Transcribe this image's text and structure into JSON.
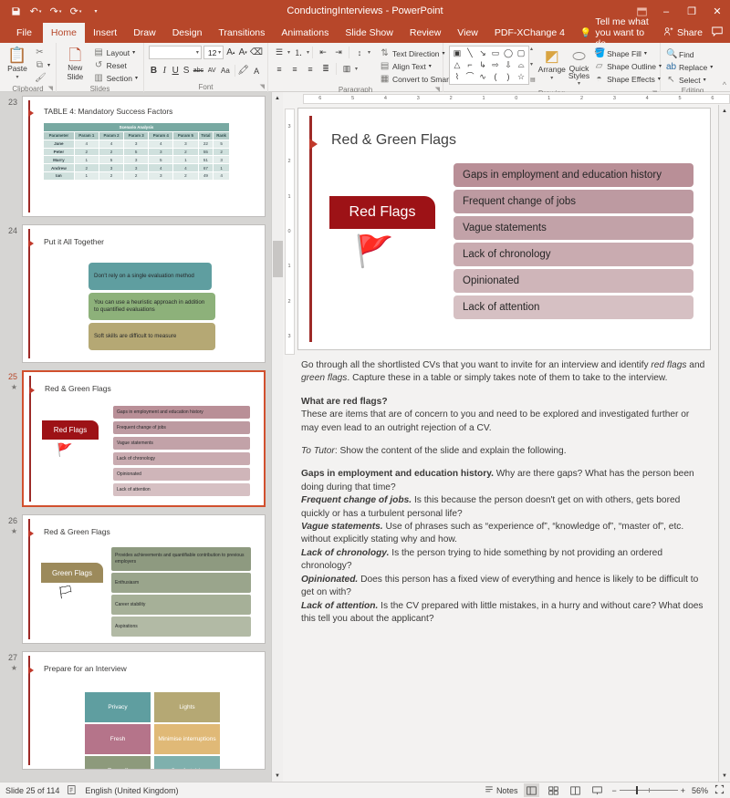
{
  "titlebar": {
    "document_title": "ConductingInterviews  -  PowerPoint",
    "qat": [
      "save-icon",
      "undo-icon",
      "redo-icon",
      "start-slideshow-icon",
      "customize-qat-icon"
    ],
    "ribbon_display_options": "ribbon-display-options-icon",
    "minimize": "–",
    "restore": "❐",
    "close": "✕"
  },
  "tabs": [
    {
      "label": "File",
      "active": false
    },
    {
      "label": "Home",
      "active": true
    },
    {
      "label": "Insert",
      "active": false
    },
    {
      "label": "Draw",
      "active": false
    },
    {
      "label": "Design",
      "active": false
    },
    {
      "label": "Transitions",
      "active": false
    },
    {
      "label": "Animations",
      "active": false
    },
    {
      "label": "Slide Show",
      "active": false
    },
    {
      "label": "Review",
      "active": false
    },
    {
      "label": "View",
      "active": false
    },
    {
      "label": "PDF-XChange 4",
      "active": false
    }
  ],
  "tellme": "Tell me what you want to do",
  "share_label": "Share",
  "ribbon": {
    "groups": {
      "clipboard": {
        "label": "Clipboard",
        "paste": "Paste",
        "cut": "Cut",
        "copy": "Copy",
        "format_painter": "Format Painter"
      },
      "slides": {
        "label": "Slides",
        "new_slide": "New Slide",
        "layout": "Layout",
        "reset": "Reset",
        "section": "Section"
      },
      "font": {
        "label": "Font",
        "font_name": "",
        "font_size": "12",
        "bold": "B",
        "italic": "I",
        "underline": "U",
        "shadow": "S",
        "strikethrough": "abc",
        "char_spacing": "AV",
        "change_case": "Aa",
        "grow_font": "A",
        "shrink_font": "A",
        "clear_formatting": "clear-formatting-icon",
        "text_highlight": "text-highlight-icon",
        "font_color": "A"
      },
      "paragraph": {
        "label": "Paragraph",
        "bullets": "bullets-icon",
        "numbering": "numbering-icon",
        "decrease_indent": "decrease-indent-icon",
        "increase_indent": "increase-indent-icon",
        "line_spacing": "line-spacing-icon",
        "text_direction": "Text Direction",
        "align_text": "Align Text",
        "convert_smartart": "Convert to SmartArt",
        "align_left": "align-left-icon",
        "align_center": "align-center-icon",
        "align_right": "align-right-icon",
        "justify": "justify-icon",
        "columns": "columns-icon"
      },
      "drawing": {
        "label": "Drawing",
        "arrange": "Arrange",
        "quick_styles": "Quick Styles",
        "shape_fill": "Shape Fill",
        "shape_outline": "Shape Outline",
        "shape_effects": "Shape Effects",
        "shape_glyphs": [
          "▣",
          "╲",
          "↘",
          "▭",
          "◯",
          "▢",
          "△",
          "⌐",
          "↳",
          "⇨",
          "⇩",
          "⌒",
          "⌇",
          "⌒",
          "∿",
          "(",
          ")",
          "☆"
        ]
      },
      "editing": {
        "label": "Editing",
        "find": "Find",
        "replace": "Replace",
        "select": "Select"
      }
    },
    "collapse_ribbon": "^"
  },
  "ruler": {
    "horizontal_ticks": [
      "6",
      "5",
      "4",
      "3",
      "2",
      "1",
      "0",
      "1",
      "2",
      "3",
      "4",
      "5",
      "6"
    ],
    "vertical_ticks": [
      "3",
      "2",
      "1",
      "0",
      "1",
      "2",
      "3"
    ]
  },
  "thumbnails": [
    {
      "number": "23",
      "animated": false,
      "selected": false,
      "title": "TABLE 4: Mandatory Success Factors",
      "kind": "table",
      "table": {
        "caption": "Scenario Analysis",
        "headers": [
          "Parameter",
          "Param 1",
          "Param 2",
          "Param 3",
          "Param 4",
          "Param 5",
          "Total",
          "Rank"
        ],
        "rows": [
          [
            "Jane",
            "4",
            "4",
            "3",
            "4",
            "3",
            "22",
            "5"
          ],
          [
            "Peter",
            "2",
            "2",
            "5",
            "3",
            "2",
            "55",
            "2"
          ],
          [
            "Marry",
            "1",
            "5",
            "3",
            "5",
            "1",
            "51",
            "3"
          ],
          [
            "Andrew",
            "2",
            "3",
            "3",
            "4",
            "4",
            "67",
            "1"
          ],
          [
            "Ian",
            "1",
            "2",
            "2",
            "3",
            "2",
            "49",
            "4"
          ]
        ]
      }
    },
    {
      "number": "24",
      "animated": false,
      "selected": false,
      "title": "Put it All Together",
      "kind": "pills",
      "pills": [
        {
          "text": "Don't rely on a single evaluation method",
          "color": "#5f9ea0"
        },
        {
          "text": "You can use a heuristic approach in addition to quantified evaluations",
          "color": "#8db17a"
        },
        {
          "text": "Soft skills are difficult to measure",
          "color": "#b5a874"
        }
      ]
    },
    {
      "number": "25",
      "animated": true,
      "selected": true,
      "title": "Red & Green Flags",
      "kind": "flags",
      "badge": {
        "text": "Red Flags",
        "color": "#9d1216"
      },
      "flag_icon": "red-flag-icon",
      "items": [
        {
          "text": "Gaps in employment and education history",
          "color": "#b98f97"
        },
        {
          "text": "Frequent change of jobs",
          "color": "#bd9aa1"
        },
        {
          "text": "Vague statements",
          "color": "#c2a2a8"
        },
        {
          "text": "Lack of chronology",
          "color": "#c9abb0"
        },
        {
          "text": "Opinionated",
          "color": "#cfb5b9"
        },
        {
          "text": "Lack of attention",
          "color": "#d6c0c3"
        }
      ]
    },
    {
      "number": "26",
      "animated": true,
      "selected": false,
      "title": "Red & Green Flags",
      "kind": "flags",
      "badge": {
        "text": "Green Flags",
        "color": "#9c8a5b"
      },
      "flag_icon": "green-flag-icon",
      "items": [
        {
          "text": "Provides achievements and quantifiable contribution to previous employers",
          "color": "#8e9a80"
        },
        {
          "text": "Enthusiasm",
          "color": "#9aa58c"
        },
        {
          "text": "Career stability",
          "color": "#a6b098"
        },
        {
          "text": "Aspirations",
          "color": "#b2baa5"
        }
      ]
    },
    {
      "number": "27",
      "animated": true,
      "selected": false,
      "title": "Prepare for an Interview",
      "kind": "tiles",
      "tiles": [
        {
          "text": "Privacy",
          "color": "#5f9ea0"
        },
        {
          "text": "Lights",
          "color": "#b5a874"
        },
        {
          "text": "Fresh",
          "color": "#b5748a"
        },
        {
          "text": "Minimise interruptions",
          "color": "#e0b977"
        },
        {
          "text": "Turn off",
          "color": "#8d9a7c"
        },
        {
          "text": "Comfortable",
          "color": "#7fb0ad"
        }
      ]
    }
  ],
  "slide": {
    "title": "Red & Green Flags",
    "badge_label": "Red Flags",
    "badge_color": "#9d1216",
    "flag_icon": "red-flag-icon",
    "items": [
      {
        "text": "Gaps in employment and education history",
        "color": "#b98f97"
      },
      {
        "text": "Frequent change of jobs",
        "color": "#bd9aa1"
      },
      {
        "text": "Vague statements",
        "color": "#c2a2a8"
      },
      {
        "text": "Lack of chronology",
        "color": "#c9abb0"
      },
      {
        "text": "Opinionated",
        "color": "#cfb5b9"
      },
      {
        "text": "Lack of attention",
        "color": "#d6c0c3"
      }
    ]
  },
  "notes": {
    "p1_a": "Go through all the shortlisted CVs that you want to invite for an interview and identify ",
    "p1_i1": "red flags",
    "p1_b": " and ",
    "p1_i2": "green flags",
    "p1_c": ". Capture these in a table or simply takes note of them to take to the interview.",
    "heading1": "What are red flags?",
    "p2": "These are items that are of concern to you and need to be explored and investigated further or may even lead to an outright rejection of a CV.",
    "p3_i": "To Tutor",
    "p3_t": ": Show the content of the slide and explain the following.",
    "bullets": [
      {
        "lead": "Gaps in employment and education history.",
        "style": "bold",
        "text": " Why are there gaps? What has the person been doing during that time?"
      },
      {
        "lead": "Frequent change of jobs.",
        "style": "bold-italic",
        "text": " Is this because the person doesn't get on with others, gets bored quickly or has a turbulent personal life?"
      },
      {
        "lead": "Vague statements.",
        "style": "bold-italic",
        "text": " Use of phrases such as “experience of”, “knowledge of”, “master of”, etc. without explicitly stating why and how."
      },
      {
        "lead": "Lack of chronology.",
        "style": "bold-italic",
        "text": " Is the person trying to hide something by not providing an ordered chronology?"
      },
      {
        "lead": "Opinionated.",
        "style": "bold-italic",
        "text": " Does this person has a fixed view of everything and hence is likely to be difficult to get on with?"
      },
      {
        "lead": "Lack of attention.",
        "style": "bold-italic",
        "text": " Is the CV prepared with little mistakes, in a hurry and without care? What does this tell you about the applicant?"
      }
    ]
  },
  "statusbar": {
    "slide_counter": "Slide 25 of 114",
    "accessibility_icon": "accessibility-checker-icon",
    "language": "English (United Kingdom)",
    "notes_label": "Notes",
    "views": [
      "normal-view-icon",
      "slide-sorter-icon",
      "reading-view-icon",
      "slideshow-icon"
    ],
    "zoom_out": "−",
    "zoom_in": "+",
    "zoom_level": "56%",
    "fit_to_window": "fit-to-window-icon"
  },
  "colors": {
    "brand": "#b7472a",
    "ribbon_bg": "#f3f2f1",
    "selection": "#d1502e",
    "accent_bar": "#9d2a27"
  }
}
